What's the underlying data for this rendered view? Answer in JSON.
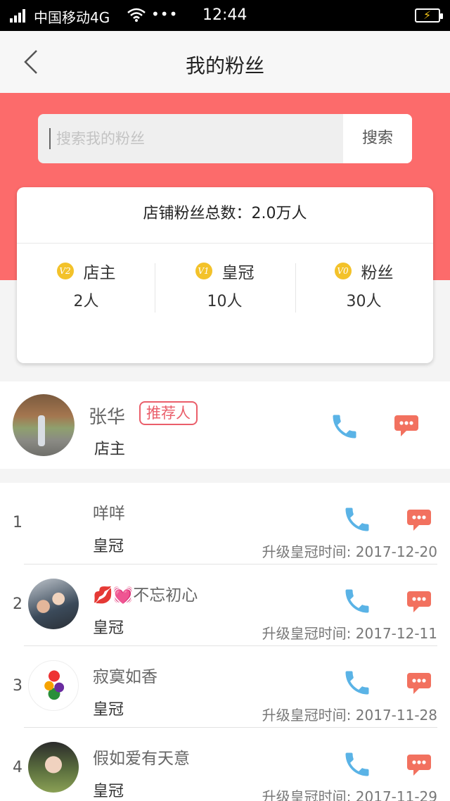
{
  "status_bar": {
    "carrier": "中国移动4G",
    "dots": "•••",
    "time": "12:44"
  },
  "nav": {
    "title": "我的粉丝"
  },
  "search": {
    "placeholder": "搜索我的粉丝",
    "button_label": "搜索"
  },
  "stats": {
    "total": "店铺粉丝总数：2.0万人",
    "levels": [
      {
        "badge": "V2",
        "label": "店主",
        "count": "2人"
      },
      {
        "badge": "V1",
        "label": "皇冠",
        "count": "10人"
      },
      {
        "badge": "V0",
        "label": "粉丝",
        "count": "30人"
      }
    ]
  },
  "referrer": {
    "name": "张华",
    "tag": "推荐人",
    "role": "店主"
  },
  "fans": [
    {
      "index": "1",
      "nickname": "咩咩",
      "level": "皇冠",
      "upgrade_time": "升级皇冠时间: 2017-12-20"
    },
    {
      "index": "2",
      "nickname": "💋💓不忘初心",
      "level": "皇冠",
      "upgrade_time": "升级皇冠时间: 2017-12-11"
    },
    {
      "index": "3",
      "nickname": "寂寞如香",
      "level": "皇冠",
      "upgrade_time": "升级皇冠时间: 2017-11-28"
    },
    {
      "index": "4",
      "nickname": "假如爱有天意",
      "level": "皇冠",
      "upgrade_time": "升级皇冠时间: 2017-11-29"
    }
  ],
  "colors": {
    "header_red": "#fc6b6b",
    "phone_blue": "#5ab3e6",
    "chat_red": "#f2715f",
    "badge_gold": "#f3c22a",
    "tag_red": "#ea5e6a"
  }
}
